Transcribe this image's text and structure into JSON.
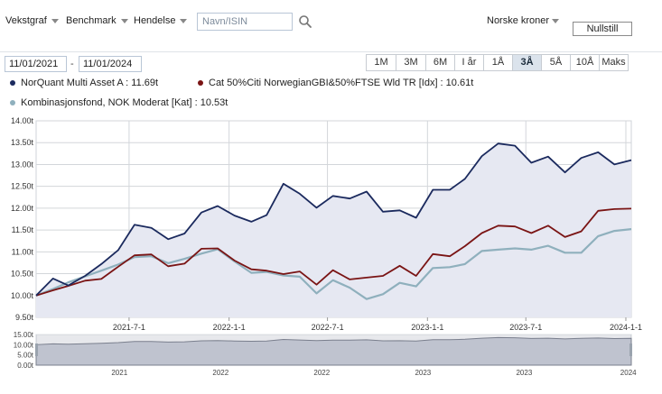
{
  "toolbar": {
    "chart_type_label": "Vekstgraf",
    "benchmark_label": "Benchmark",
    "event_label": "Hendelse",
    "search_placeholder": "Navn/ISIN",
    "currency_label": "Norske kroner",
    "reset_label": "Nullstill"
  },
  "dates": {
    "from": "11/01/2021",
    "separator": "-",
    "to": "11/01/2024"
  },
  "periods": [
    {
      "label": "1M",
      "active": false
    },
    {
      "label": "3M",
      "active": false
    },
    {
      "label": "6M",
      "active": false
    },
    {
      "label": "I år",
      "active": false
    },
    {
      "label": "1Å",
      "active": false
    },
    {
      "label": "3Å",
      "active": true
    },
    {
      "label": "5Å",
      "active": false
    },
    {
      "label": "10Å",
      "active": false
    },
    {
      "label": "Maks",
      "active": false
    }
  ],
  "colors": {
    "series1": "#1b2a5e",
    "series2": "#7a1414",
    "series3": "#8fb0bd",
    "area_fill": "#e6e8f2",
    "grid": "#d3d6da",
    "accent": "#2b6cb0"
  },
  "legend": [
    {
      "text": "NorQuant Multi Asset A : 11.69t"
    },
    {
      "text": "Cat 50%Citi NorwegianGBI&50%FTSE Wld TR [Idx] : 10.61t"
    },
    {
      "text": "Kombinasjonsfond, NOK Moderat [Kat] : 10.53t"
    }
  ],
  "chart_data": {
    "type": "line",
    "x": [
      "2021-01-11",
      "2021-02-11",
      "2021-03-11",
      "2021-04-11",
      "2021-05-11",
      "2021-06-11",
      "2021-07-11",
      "2021-08-11",
      "2021-09-11",
      "2021-10-11",
      "2021-11-11",
      "2021-12-11",
      "2022-01-11",
      "2022-02-11",
      "2022-03-11",
      "2022-04-11",
      "2022-05-11",
      "2022-06-11",
      "2022-07-11",
      "2022-08-11",
      "2022-09-11",
      "2022-10-11",
      "2022-11-11",
      "2022-12-11",
      "2023-01-11",
      "2023-02-11",
      "2023-03-11",
      "2023-04-11",
      "2023-05-11",
      "2023-06-11",
      "2023-07-11",
      "2023-08-11",
      "2023-09-11",
      "2023-10-11",
      "2023-11-11",
      "2023-12-11",
      "2024-01-11"
    ],
    "series": [
      {
        "values": [
          10.0,
          10.39,
          10.23,
          10.45,
          10.72,
          11.04,
          11.62,
          11.55,
          11.29,
          11.42,
          11.9,
          12.05,
          11.83,
          11.69,
          11.84,
          12.56,
          12.33,
          12.01,
          12.28,
          12.22,
          12.38,
          11.92,
          11.95,
          11.78,
          12.42,
          12.42,
          12.67,
          13.19,
          13.48,
          13.43,
          13.04,
          13.18,
          12.82,
          13.15,
          13.28,
          13.0,
          13.1
        ]
      },
      {
        "values": [
          10.0,
          10.12,
          10.22,
          10.34,
          10.38,
          10.66,
          10.92,
          10.94,
          10.67,
          10.73,
          11.07,
          11.08,
          10.8,
          10.6,
          10.57,
          10.49,
          10.55,
          10.25,
          10.58,
          10.37,
          10.41,
          10.45,
          10.68,
          10.45,
          10.95,
          10.9,
          11.13,
          11.43,
          11.6,
          11.58,
          11.43,
          11.6,
          11.34,
          11.47,
          11.94,
          11.98,
          11.99
        ]
      },
      {
        "values": [
          10.0,
          10.15,
          10.3,
          10.44,
          10.57,
          10.71,
          10.88,
          10.9,
          10.74,
          10.84,
          10.96,
          11.06,
          10.78,
          10.52,
          10.54,
          10.46,
          10.43,
          10.05,
          10.35,
          10.18,
          9.92,
          10.03,
          10.29,
          10.21,
          10.63,
          10.65,
          10.72,
          11.02,
          11.05,
          11.08,
          11.05,
          11.14,
          10.98,
          10.98,
          11.36,
          11.48,
          11.52
        ]
      }
    ],
    "ylim": [
      9.5,
      14.0
    ],
    "y_ticks": [
      "9.50t",
      "10.00t",
      "10.50t",
      "11.00t",
      "11.50t",
      "12.00t",
      "12.50t",
      "13.00t",
      "13.50t",
      "14.00t"
    ],
    "x_ticks": [
      "2021-7-1",
      "2022-1-1",
      "2022-7-1",
      "2023-1-1",
      "2023-7-1",
      "2024-1-1"
    ],
    "grid": true,
    "legend_position": "top-left",
    "navigator": {
      "y_ticks": [
        "15.00t",
        "10.00t",
        "5.00t",
        "0.00t"
      ],
      "ylim": [
        0,
        15
      ],
      "x_ticks": [
        "2021",
        "2022",
        "2022",
        "2023",
        "2023",
        "2024"
      ]
    }
  }
}
